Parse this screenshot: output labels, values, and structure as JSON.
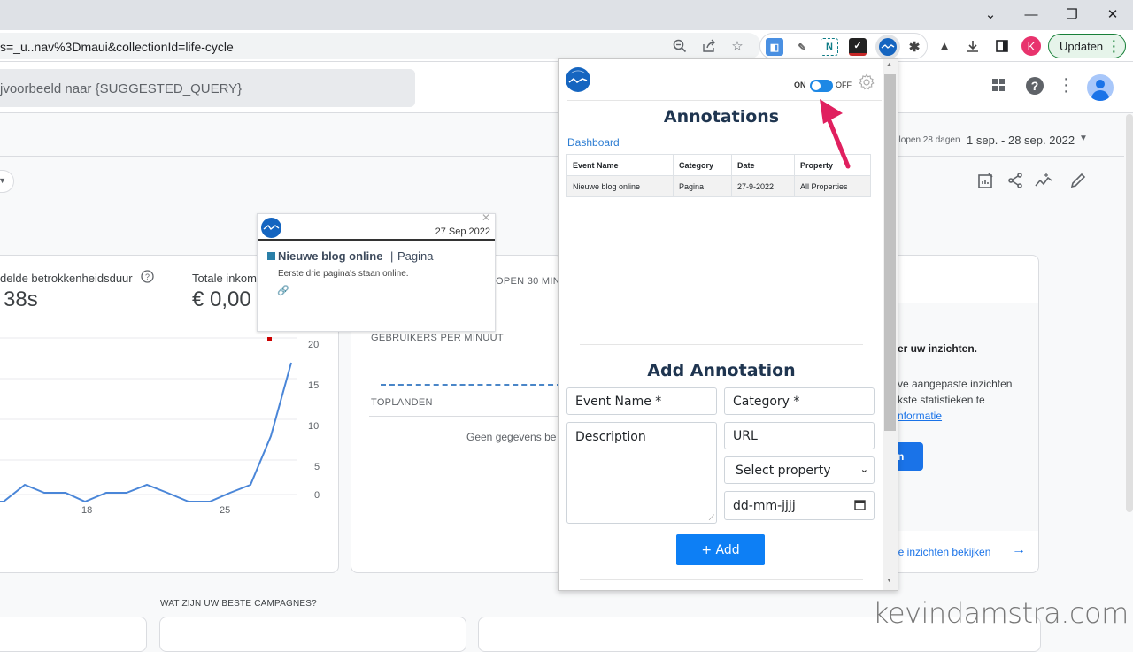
{
  "browser": {
    "url": "s=_u..nav%3Dmaui&collectionId=life-cycle",
    "window_controls": [
      "tab-search",
      "minimize",
      "restore",
      "close"
    ],
    "toolbar_icons": [
      "zoom-out-icon",
      "share-icon",
      "bookmark-star-icon"
    ],
    "extensions": [
      "tag-assistant-icon",
      "dataslayer-icon",
      "notion-icon",
      "checklist-icon",
      "annotations-icon",
      "extensions-puzzle-icon"
    ],
    "extra_icons": [
      "labs-flask-icon",
      "download-icon",
      "sidepanel-icon"
    ],
    "profile_initial": "K",
    "update_label": "Updaten"
  },
  "ga": {
    "search_placeholder": "jvoorbeeld naar {SUGGESTED_QUERY}",
    "date_compare_label": "elopen 28 dagen",
    "date_range": "1 sep. - 28 sep. 2022",
    "metrics": [
      {
        "label": "delde betrokkenheidsduur",
        "value": "38s"
      },
      {
        "label": "Totale inkom",
        "value": "€ 0,00"
      }
    ],
    "chart": {
      "y_ticks": [
        "20",
        "15",
        "10",
        "5",
        "0"
      ],
      "x_ticks": [
        "18",
        "25"
      ]
    },
    "realtime": {
      "title_fragment": "OPEN 30 MINU",
      "users_per_minute": "GEBRUIKERS PER MINUUT",
      "top_countries": "TOPLANDEN",
      "no_data": "Geen gegevens be"
    },
    "insights": {
      "heading": "er uw inzichten.",
      "body_line1": "ve aangepaste inzichten",
      "body_line2": "kste statistieken te",
      "link": "nformatie",
      "button_fragment": "n",
      "view_all": "le inzichten bekijken"
    },
    "campaigns_caption": "WAT ZIJN UW BESTE CAMPAGNES?"
  },
  "annotation_tooltip": {
    "date": "27 Sep 2022",
    "event_name": "Nieuwe blog online",
    "separator": "|",
    "category": "Pagina",
    "description": "Eerste drie pagina's staan online.",
    "category_color": "#2a7fa8"
  },
  "popup": {
    "toggle_on": "ON",
    "toggle_off": "OFF",
    "toggle_state": "on",
    "title": "Annotations",
    "dashboard_link": "Dashboard",
    "table": {
      "headers": [
        "Event Name",
        "Category",
        "Date",
        "Property"
      ],
      "rows": [
        [
          "Nieuwe blog online",
          "Pagina",
          "27-9-2022",
          "All Properties"
        ]
      ]
    },
    "add_title": "Add Annotation",
    "form": {
      "event_name_placeholder": "Event Name *",
      "category_placeholder": "Category *",
      "description_placeholder": "Description",
      "url_placeholder": "URL",
      "property_select": "Select property",
      "date_placeholder": "dd-mm-jjjj",
      "add_button": "+ Add"
    },
    "accent_color": "#0d7ff5"
  },
  "watermark": "kevindamstra.com"
}
